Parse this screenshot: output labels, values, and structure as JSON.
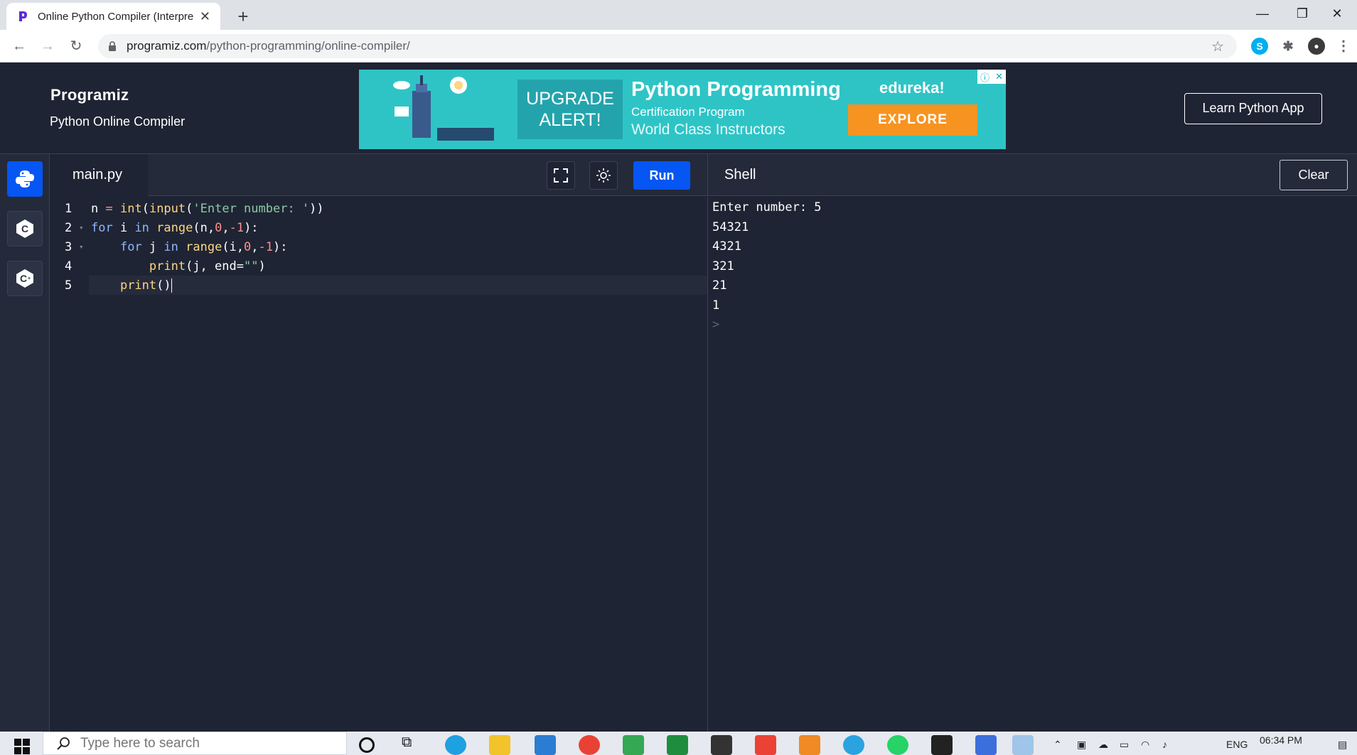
{
  "browser": {
    "tab_title": "Online Python Compiler (Interpre",
    "url_host": "programiz.com",
    "url_path": "/python-programming/online-compiler/"
  },
  "header": {
    "logo": "Programiz",
    "subtitle": "Python Online Compiler",
    "learn_button": "Learn Python App"
  },
  "ad": {
    "upgrade_line1": "UPGRADE",
    "upgrade_line2": "ALERT!",
    "headline": "Python Programming",
    "line1": "Certification Program",
    "line2": "World Class Instructors",
    "brand": "edureka!",
    "cta": "EXPLORE"
  },
  "editor": {
    "file_name": "main.py",
    "run_label": "Run",
    "line_numbers": [
      "1",
      "2",
      "3",
      "4",
      "5"
    ]
  },
  "shell": {
    "title": "Shell",
    "clear_label": "Clear",
    "output": [
      "Enter number: 5",
      "54321",
      "4321",
      "321",
      "21",
      "1"
    ],
    "prompt": ">"
  },
  "taskbar": {
    "search_placeholder": "Type here to search",
    "language": "ENG",
    "time": "06:34 PM"
  },
  "colors": {
    "accent": "#0556f3",
    "background": "#1e2433",
    "panel": "#242a3a"
  }
}
